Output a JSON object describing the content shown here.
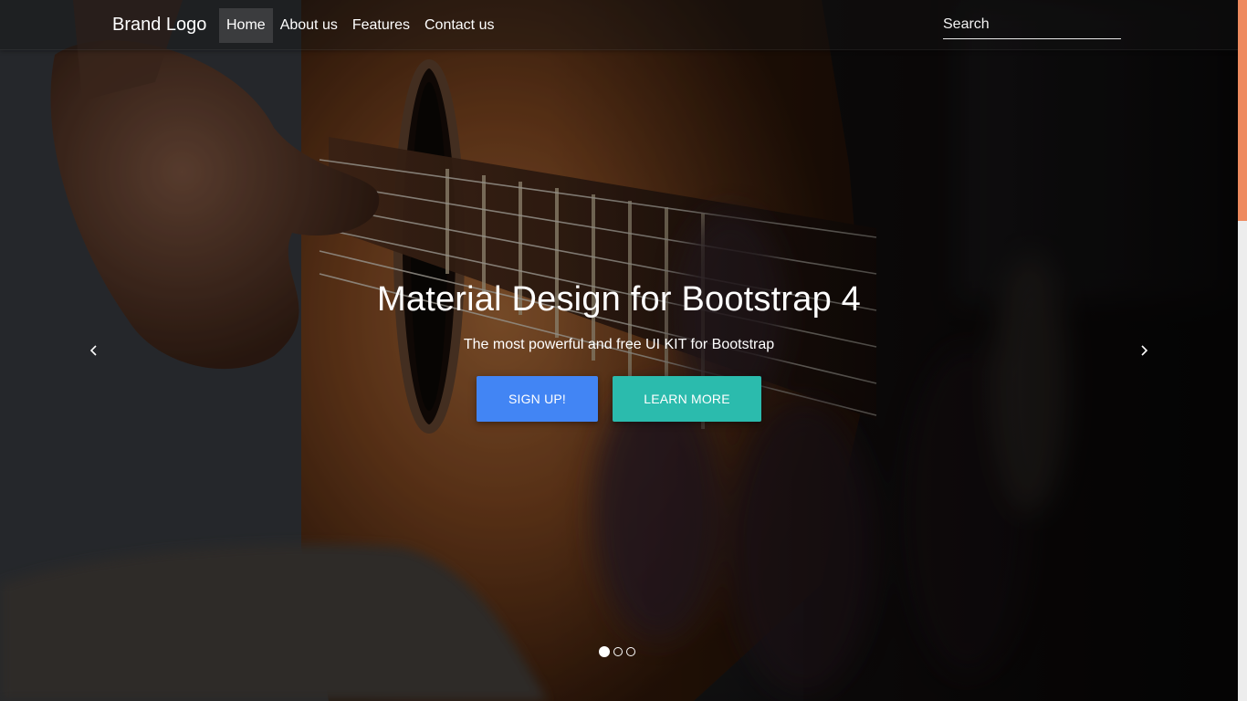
{
  "navbar": {
    "brand": "Brand Logo",
    "items": [
      {
        "label": "Home",
        "active": true
      },
      {
        "label": "About us",
        "active": false
      },
      {
        "label": "Features",
        "active": false
      },
      {
        "label": "Contact us",
        "active": false
      }
    ],
    "search_placeholder": "Search"
  },
  "hero": {
    "title": "Material Design for Bootstrap 4",
    "subtitle": "The most powerful and free UI KIT for Bootstrap",
    "signup_label": "SIGN UP!",
    "learn_more_label": "LEARN MORE",
    "prev_icon": "chevron-left-icon",
    "next_icon": "chevron-right-icon",
    "slides_count": 3,
    "active_slide": 1
  },
  "colors": {
    "signup_button": "#4285f4",
    "learn_more_button": "#2bbbad",
    "scrollbar_thumb": "#ee8a5f"
  }
}
